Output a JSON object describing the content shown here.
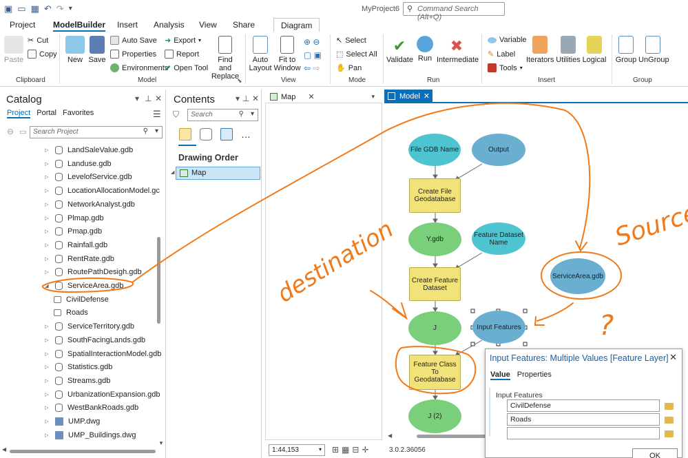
{
  "app": {
    "title": "MyProject6",
    "command_search_placeholder": "Command Search (Alt+Q)"
  },
  "ribbon_tabs": [
    "Project",
    "ModelBuilder",
    "Insert",
    "Analysis",
    "View",
    "Share",
    "Diagram"
  ],
  "ribbon": {
    "clipboard": {
      "paste": "Paste",
      "cut": "Cut",
      "copy": "Copy",
      "label": "Clipboard"
    },
    "model": {
      "new": "New",
      "save": "Save",
      "auto_save": "Auto Save",
      "properties": "Properties",
      "environments": "Environments",
      "export": "Export",
      "report": "Report",
      "open_tool": "Open Tool",
      "find_replace": "Find and Replace",
      "label": "Model"
    },
    "view": {
      "auto_layout": "Auto Layout",
      "fit_to_window": "Fit to Window",
      "label": "View"
    },
    "mode": {
      "select": "Select",
      "select_all": "Select All",
      "pan": "Pan",
      "label": "Mode"
    },
    "run": {
      "validate": "Validate",
      "run": "Run",
      "intermediate": "Intermediate",
      "label": "Run"
    },
    "insert": {
      "variable": "Variable",
      "label_item": "Label",
      "tools": "Tools",
      "iterators": "Iterators",
      "utilities": "Utilities",
      "logical": "Logical",
      "label": "Insert"
    },
    "group": {
      "group": "Group",
      "ungroup": "UnGroup",
      "label": "Group"
    }
  },
  "catalog": {
    "title": "Catalog",
    "tabs": [
      "Project",
      "Portal",
      "Favorites"
    ],
    "search_placeholder": "Search Project",
    "items": [
      {
        "name": "LandSaleValue.gdb",
        "type": "gdb"
      },
      {
        "name": "Landuse.gdb",
        "type": "gdb"
      },
      {
        "name": "LevelofService.gdb",
        "type": "gdb"
      },
      {
        "name": "LocationAllocationModel.gc",
        "type": "gdb"
      },
      {
        "name": "NetworkAnalyst.gdb",
        "type": "gdb"
      },
      {
        "name": "Plmap.gdb",
        "type": "gdb"
      },
      {
        "name": "Pmap.gdb",
        "type": "gdb"
      },
      {
        "name": "Rainfall.gdb",
        "type": "gdb"
      },
      {
        "name": "RentRate.gdb",
        "type": "gdb"
      },
      {
        "name": "RoutePathDesigh.gdb",
        "type": "gdb"
      },
      {
        "name": "ServiceArea.gdb",
        "type": "gdb-open"
      },
      {
        "name": "CivilDefense",
        "type": "fc"
      },
      {
        "name": "Roads",
        "type": "fc"
      },
      {
        "name": "ServiceTerritory.gdb",
        "type": "gdb"
      },
      {
        "name": "SouthFacingLands.gdb",
        "type": "gdb"
      },
      {
        "name": "SpatialInteractionModel.gdb",
        "type": "gdb"
      },
      {
        "name": "Statistics.gdb",
        "type": "gdb"
      },
      {
        "name": "Streams.gdb",
        "type": "gdb"
      },
      {
        "name": "UrbanizationExpansion.gdb",
        "type": "gdb"
      },
      {
        "name": "WestBankRoads.gdb",
        "type": "gdb"
      },
      {
        "name": "UMP.dwg",
        "type": "cad"
      },
      {
        "name": "UMP_Buildings.dwg",
        "type": "cad"
      }
    ]
  },
  "contents": {
    "title": "Contents",
    "search_placeholder": "Search",
    "drawing_order": "Drawing Order",
    "map_item": "Map"
  },
  "map_tab": "Map",
  "map_scale": "1:44,153",
  "model_tab": "Model",
  "model_nodes": {
    "file_gdb_name": "File GDB Name",
    "output": "Output",
    "create_file_gdb": "Create File Geodatabase",
    "y_gdb": "Y.gdb",
    "feature_dataset_name": "Feature Dataset Name",
    "create_feature_dataset": "Create Feature Dataset",
    "j": "J",
    "input_features": "Input Features",
    "feature_class_to_gdb": "Feature Class To Geodatabase",
    "j2": "J (2)",
    "service_area_gdb": "ServiceArea.gdb"
  },
  "annotations": {
    "destination": "destination",
    "source": "Source",
    "question": "?"
  },
  "popup": {
    "title": "Input Features: Multiple Values [Feature Layer]",
    "tabs": [
      "Value",
      "Properties"
    ],
    "label": "Input Features",
    "values": [
      "CivilDefense",
      "Roads",
      ""
    ],
    "ok": "OK"
  },
  "version": "3.0.2.36056",
  "colors": {
    "accent": "#0b6fb7",
    "annotation": "#f07a1a"
  }
}
